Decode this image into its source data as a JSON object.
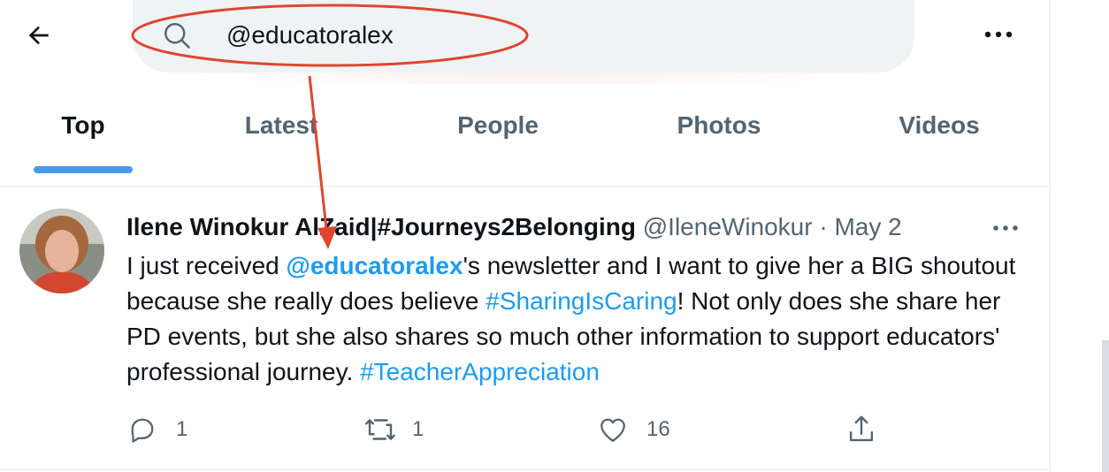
{
  "header": {
    "back_icon": "arrow-left-icon",
    "search_icon": "search-icon",
    "search_value": "@educatoralex",
    "more_icon": "more-horizontal-icon"
  },
  "tabs": [
    {
      "label": "Top",
      "active": true
    },
    {
      "label": "Latest",
      "active": false
    },
    {
      "label": "People",
      "active": false
    },
    {
      "label": "Photos",
      "active": false
    },
    {
      "label": "Videos",
      "active": false
    }
  ],
  "tweet": {
    "author_name": "Ilene Winokur AlZaid|#Journeys2Belonging",
    "handle": "@IleneWinokur",
    "separator": "·",
    "date": "May 2",
    "text_segments": [
      {
        "text": "I just received ",
        "kind": "plain"
      },
      {
        "text": "@educatoralex",
        "kind": "mention"
      },
      {
        "text": "'s newsletter and I want to give her a BIG shoutout because she really does believe ",
        "kind": "plain"
      },
      {
        "text": "#SharingIsCaring",
        "kind": "hashtag"
      },
      {
        "text": "! Not only does she share her PD events, but she also shares so much other information to support educators' professional journey. ",
        "kind": "plain"
      },
      {
        "text": "#TeacherAppreciation",
        "kind": "hashtag"
      }
    ],
    "actions": {
      "reply_count": "1",
      "retweet_count": "1",
      "like_count": "16"
    }
  },
  "colors": {
    "accent": "#1d9bf0",
    "tab_underline": "#4a99e9",
    "secondary_text": "#536471",
    "annotation_red": "#e0452f"
  }
}
